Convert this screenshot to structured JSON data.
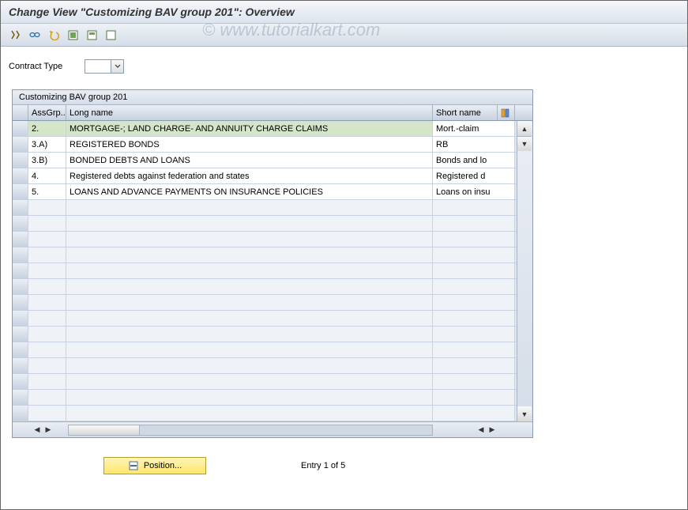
{
  "title": "Change View \"Customizing BAV group 201\": Overview",
  "watermark": "© www.tutorialkart.com",
  "toolbar": {
    "icons": [
      "other-view",
      "glasses",
      "undo",
      "select-all",
      "select-block",
      "deselect-all"
    ]
  },
  "field": {
    "label": "Contract Type",
    "value": ""
  },
  "table": {
    "title": "Customizing BAV group 201",
    "headers": {
      "col1": "AssGrp...",
      "col2": "Long name",
      "col3": "Short name"
    },
    "rows": [
      {
        "grp": "2.",
        "long": "MORTGAGE-; LAND CHARGE- AND ANNUITY CHARGE CLAIMS",
        "short": "Mort.-claim",
        "selected": true
      },
      {
        "grp": "3.A)",
        "long": "REGISTERED BONDS",
        "short": "RB",
        "selected": false
      },
      {
        "grp": "3.B)",
        "long": "BONDED DEBTS AND LOANS",
        "short": "Bonds and lo",
        "selected": false
      },
      {
        "grp": "4.",
        "long": "Registered debts against federation and states",
        "short": "Registered d",
        "selected": false
      },
      {
        "grp": "5.",
        "long": "LOANS AND ADVANCE PAYMENTS ON INSURANCE POLICIES",
        "short": "Loans on insu",
        "selected": false
      }
    ],
    "emptyRows": 14
  },
  "footer": {
    "positionLabel": "Position...",
    "entryText": "Entry 1 of 5"
  }
}
